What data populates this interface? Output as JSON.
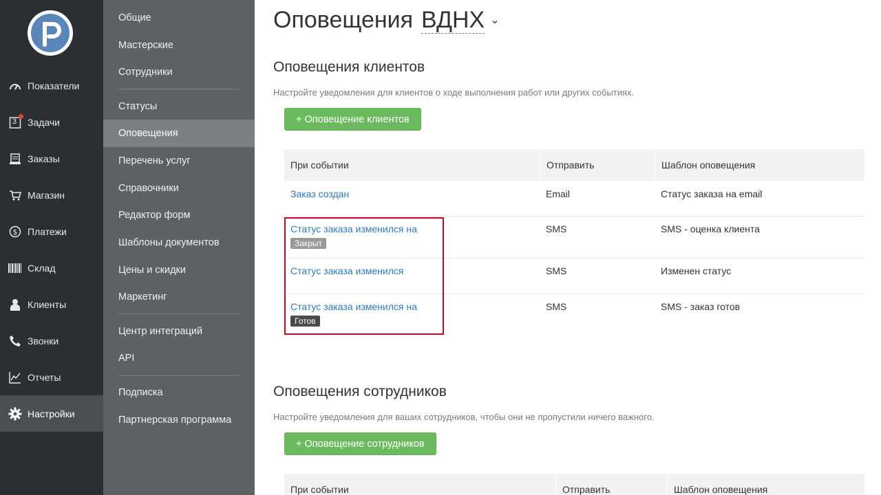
{
  "nav": {
    "items": [
      {
        "label": "Показатели",
        "icon": "gauge-icon"
      },
      {
        "label": "Задачи",
        "icon": "calendar-icon",
        "badge_text": "3"
      },
      {
        "label": "Заказы",
        "icon": "orders-icon"
      },
      {
        "label": "Магазин",
        "icon": "cart-icon"
      },
      {
        "label": "Платежи",
        "icon": "dollar-icon"
      },
      {
        "label": "Склад",
        "icon": "barcode-icon"
      },
      {
        "label": "Клиенты",
        "icon": "user-icon"
      },
      {
        "label": "Звонки",
        "icon": "phone-icon"
      },
      {
        "label": "Отчеты",
        "icon": "chart-icon"
      },
      {
        "label": "Настройки",
        "icon": "gear-icon",
        "active": true
      }
    ]
  },
  "submenu": {
    "items": [
      {
        "label": "Общие"
      },
      {
        "label": "Мастерские"
      },
      {
        "label": "Сотрудники"
      },
      {
        "label": "Статусы"
      },
      {
        "label": "Оповещения",
        "active": true
      },
      {
        "label": "Перечень услуг"
      },
      {
        "label": "Справочники"
      },
      {
        "label": "Редактор форм"
      },
      {
        "label": "Шаблоны документов"
      },
      {
        "label": "Цены и скидки"
      },
      {
        "label": "Маркетинг"
      },
      {
        "label": "Центр интеграций"
      },
      {
        "label": "API"
      },
      {
        "label": "Подписка"
      },
      {
        "label": "Партнерская программа"
      }
    ]
  },
  "page": {
    "title": "Оповещения",
    "location": "ВДНХ",
    "chevron": "⌄"
  },
  "clients": {
    "heading": "Оповещения клиентов",
    "description": "Настройте уведомления для клиентов о ходе выполнения работ или других событиях.",
    "add_button": "+ Оповещение клиентов",
    "columns": [
      "При событии",
      "Отправить",
      "Шаблон оповещения"
    ],
    "rows": [
      {
        "event": "Заказ создан",
        "badge": "",
        "send": "Email",
        "template": "Статус заказа на email"
      },
      {
        "event": "Статус заказа изменился на",
        "badge": "Закрыт",
        "send": "SMS",
        "template": "SMS - оценка клиента"
      },
      {
        "event": "Статус заказа изменился",
        "badge": "",
        "send": "SMS",
        "template": "Изменен статус"
      },
      {
        "event": "Статус заказа изменился на",
        "badge": "Готов",
        "send": "SMS",
        "template": "SMS - заказ готов"
      }
    ]
  },
  "employees": {
    "heading": "Оповещения сотрудников",
    "description": "Настройте уведомления для ваших сотрудников, чтобы они не пропустили ничего важного.",
    "add_button": "+ Оповещение сотрудников",
    "columns": [
      "При событии",
      "Отправить",
      "Шаблон оповещения"
    ]
  },
  "colors": {
    "nav_bg": "#2b2f33",
    "submenu_bg": "#5c6166",
    "accent_green": "#6cba5f",
    "link_blue": "#2f7ab8",
    "highlight_red": "#d0021b"
  }
}
